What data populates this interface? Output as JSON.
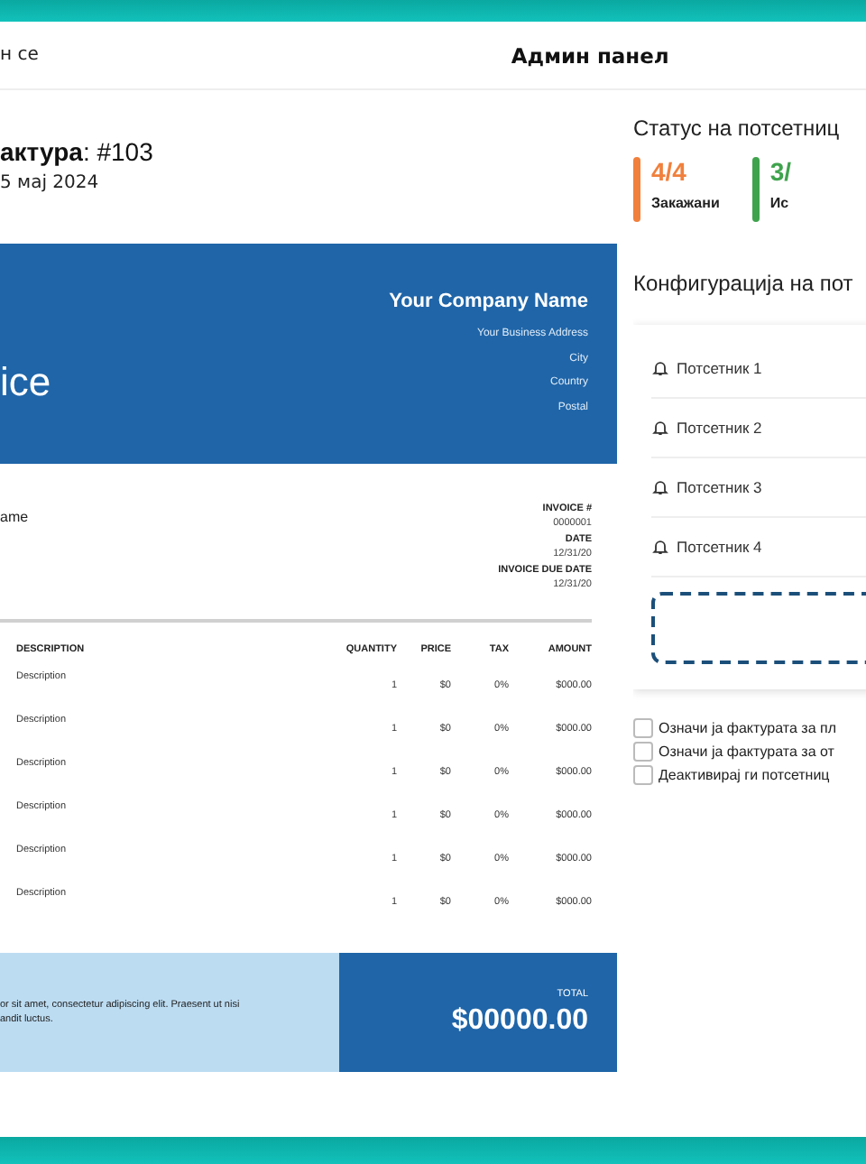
{
  "header": {
    "left_link": "н се",
    "title": "Админ панел"
  },
  "invoice_heading": {
    "title": "**актура**: #103",
    "date": "5 мај 2024"
  },
  "invoice": {
    "heading": "ice",
    "company": "Your Company Name",
    "address_lines": [
      "Your Business Address",
      "City",
      "Country",
      "Postal"
    ],
    "client": "ame",
    "meta": [
      {
        "label": "INVOICE #",
        "value": "0000001"
      },
      {
        "label": "DATE",
        "value": "12/31/20"
      },
      {
        "label": "INVOICE DUE DATE",
        "value": "12/31/20"
      }
    ],
    "columns": [
      "DESCRIPTION",
      "QUANTITY",
      "PRICE",
      "TAX",
      "AMOUNT"
    ],
    "rows": [
      {
        "description": "Description",
        "quantity": "1",
        "price": "$0",
        "tax": "0%",
        "amount": "$000.00"
      },
      {
        "description": "Description",
        "quantity": "1",
        "price": "$0",
        "tax": "0%",
        "amount": "$000.00"
      },
      {
        "description": "Description",
        "quantity": "1",
        "price": "$0",
        "tax": "0%",
        "amount": "$000.00"
      },
      {
        "description": "Description",
        "quantity": "1",
        "price": "$0",
        "tax": "0%",
        "amount": "$000.00"
      },
      {
        "description": "Description",
        "quantity": "1",
        "price": "$0",
        "tax": "0%",
        "amount": "$000.00"
      },
      {
        "description": "Description",
        "quantity": "1",
        "price": "$0",
        "tax": "0%",
        "amount": "$000.00"
      }
    ],
    "note": "or sit amet, consectetur adipiscing elit. Praesent ut nisi\nandit luctus.",
    "total_label": "TOTAL",
    "total": "$00000.00"
  },
  "status": {
    "title": "Статус на потсетниц",
    "stats": [
      {
        "value": "4/4",
        "label": "Закажани",
        "color": "#f0803c"
      },
      {
        "value": "3/",
        "label": "Ис",
        "color": "#3fa34d"
      }
    ]
  },
  "config": {
    "title": "Конфигурација на пот",
    "reminders": [
      "Потсетник 1",
      "Потсетник 2",
      "Потсетник 3",
      "Потсетник 4"
    ]
  },
  "options": [
    {
      "label": "Означи ја фактурата за пл",
      "checked": false
    },
    {
      "label": "Означи ја фактурата за от",
      "checked": false
    },
    {
      "label": "Деактивирај ги потсетниц",
      "checked": false
    }
  ]
}
